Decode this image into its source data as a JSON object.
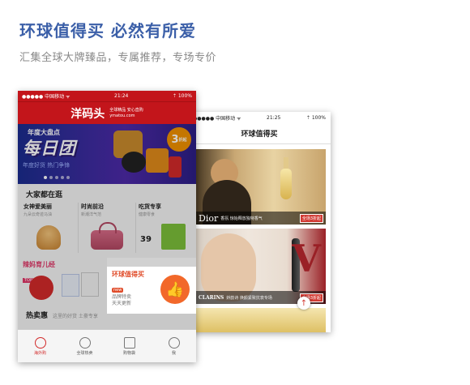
{
  "header": {
    "title": "环球值得买 必然有所爱",
    "subtitle": "汇集全球大牌臻品，专属推荐，专场专价"
  },
  "phone_right": {
    "status": {
      "carrier": "●●●●● 中国移动 ᯤ",
      "time": "21:25",
      "battery": "⇡ 100%"
    },
    "nav_title": "环球值得买",
    "banners": [
      {
        "brand": "Dior",
        "desc": "香氛 惊始释放独特香气",
        "tag": "全场3折起"
      },
      {
        "brand": "CLARINS",
        "desc": "娇韵诗 焕颜紧致抗衰专场",
        "tag": "全场3折起"
      }
    ],
    "back_top": "↑"
  },
  "phone_left": {
    "status": {
      "carrier": "●●●●● 中国移动 ᯤ",
      "time": "21:24",
      "battery": "⇡ 100%"
    },
    "logo": "洋码头",
    "logo_sub": "全球精品 安心直购",
    "logo_url": "ymatou.com",
    "promo": {
      "small": "年度大盘点",
      "big": "每日团",
      "tail": "年度好货 热门争锋",
      "discount": "3",
      "discount_unit": "折起"
    },
    "section_title": "大家都在逛",
    "columns": [
      {
        "title": "女神爱美丽",
        "sub": "九朵云奇迹马油"
      },
      {
        "title": "时尚前沿",
        "sub": "新潮洋气范"
      },
      {
        "title": "吃货专享",
        "sub": "健康零食",
        "price": "39"
      }
    ],
    "mom": {
      "title": "辣妈育儿经",
      "tag": "TOP10"
    },
    "highlight": {
      "title": "环球值得买",
      "new": "new",
      "line1": "品牌特卖",
      "line2": "天天更新",
      "icon": "👍"
    },
    "hot": {
      "title": "热卖惠",
      "sub": "这里的好货 土豪专享"
    },
    "tabs": [
      {
        "label": "海外购",
        "icon": "plane-icon",
        "active": true
      },
      {
        "label": "全球热卖",
        "icon": "globe-icon",
        "active": false
      },
      {
        "label": "购物袋",
        "icon": "bag-icon",
        "active": false
      },
      {
        "label": "我",
        "icon": "person-icon",
        "active": false
      }
    ]
  }
}
